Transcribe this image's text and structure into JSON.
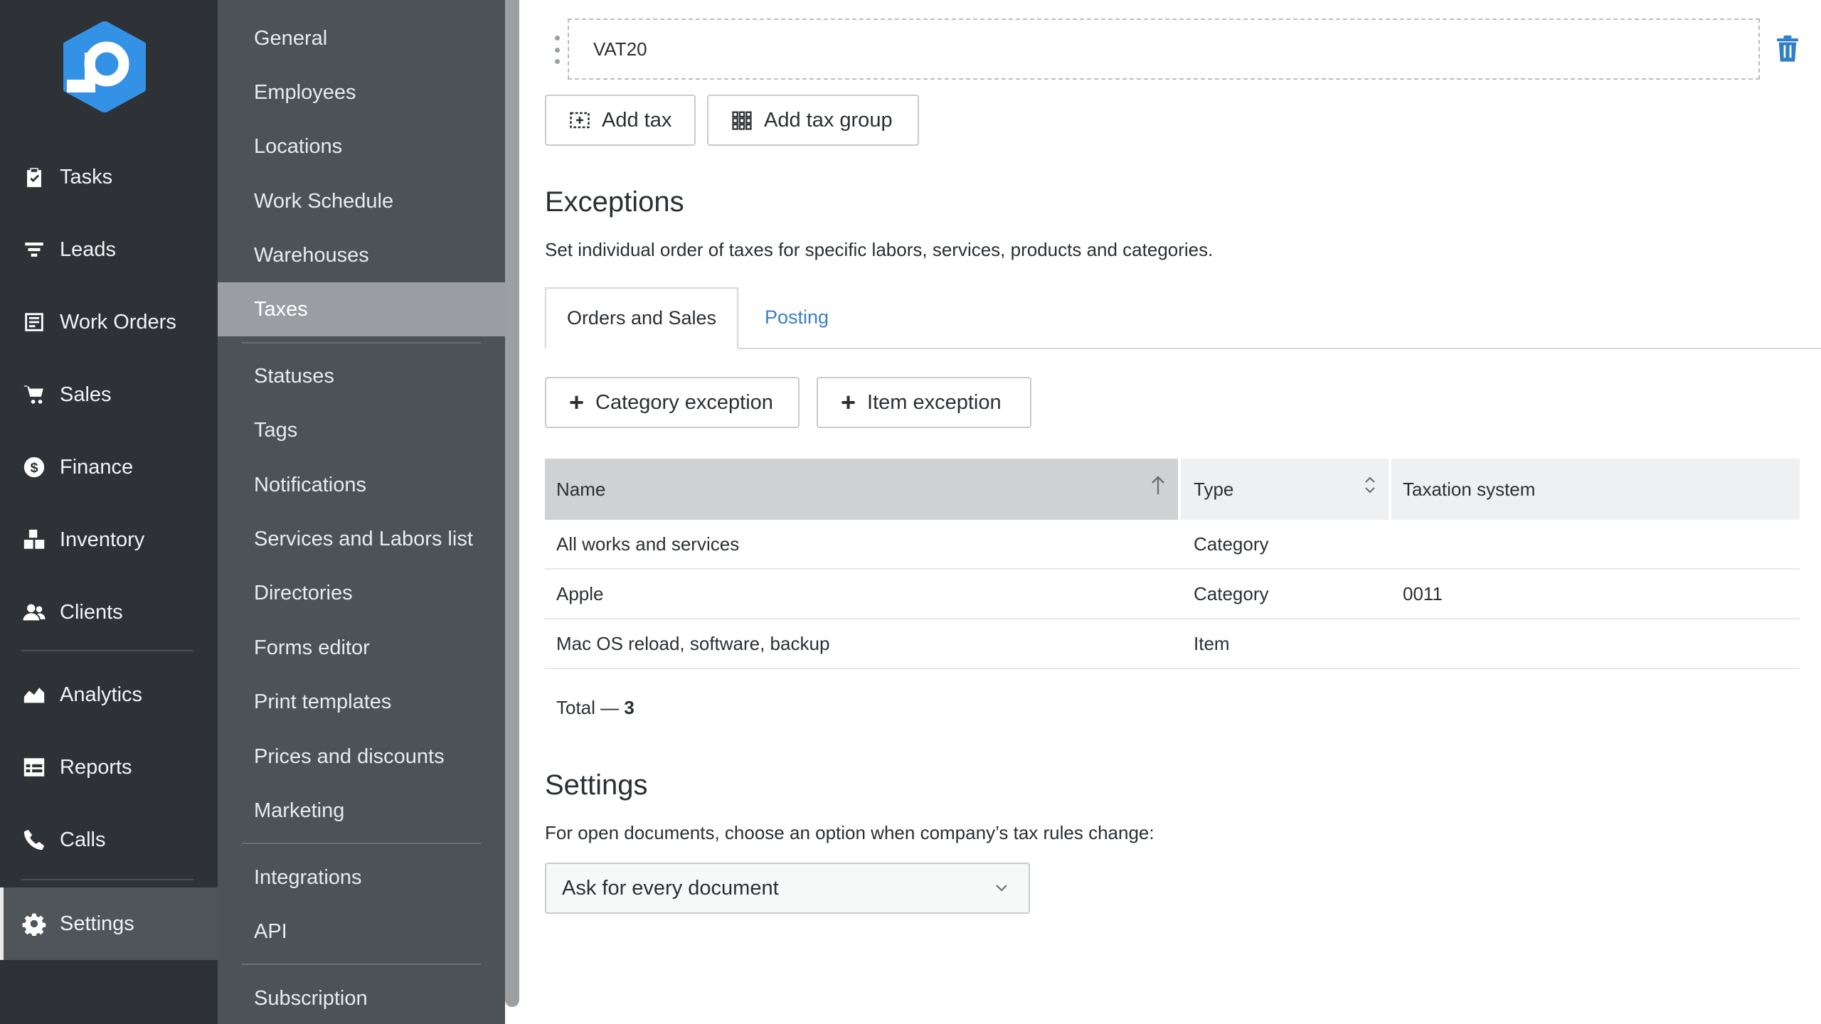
{
  "colors": {
    "primary_nav_bg": "#2e3236",
    "secondary_nav_bg": "#4d5257",
    "active_secondary_bg": "#9a9ea2",
    "logo_blue": "#3391e6",
    "link_blue": "#3b7fc4",
    "delete_icon_blue": "#2f7ec9"
  },
  "primary_nav": {
    "items": [
      {
        "label": "Tasks",
        "icon": "clipboard-check-icon"
      },
      {
        "label": "Leads",
        "icon": "filter-icon"
      },
      {
        "label": "Work Orders",
        "icon": "document-list-icon"
      },
      {
        "label": "Sales",
        "icon": "cart-icon"
      },
      {
        "label": "Finance",
        "icon": "dollar-circle-icon"
      },
      {
        "label": "Inventory",
        "icon": "boxes-icon"
      },
      {
        "label": "Clients",
        "icon": "users-icon"
      },
      {
        "label": "Analytics",
        "icon": "area-chart-icon"
      },
      {
        "label": "Reports",
        "icon": "table-icon"
      },
      {
        "label": "Calls",
        "icon": "phone-icon"
      },
      {
        "label": "Settings",
        "icon": "gear-icon",
        "active": true
      }
    ]
  },
  "settings_menu": {
    "items": [
      "General",
      "Employees",
      "Locations",
      "Work Schedule",
      "Warehouses",
      "Taxes",
      "Statuses",
      "Tags",
      "Notifications",
      "Services and Labors list",
      "Directories",
      "Forms editor",
      "Print templates",
      "Prices and discounts",
      "Marketing",
      "Integrations",
      "API",
      "Subscription"
    ],
    "active": "Taxes"
  },
  "tax_row": {
    "value": "VAT20"
  },
  "buttons": {
    "add_tax": "Add tax",
    "add_tax_group": "Add tax group",
    "category_exception": "Category exception",
    "item_exception": "Item exception"
  },
  "exceptions": {
    "title": "Exceptions",
    "description": "Set individual order of taxes for specific labors, services, products and categories.",
    "tabs": [
      {
        "label": "Orders and Sales",
        "active": true
      },
      {
        "label": "Posting",
        "active": false
      }
    ],
    "table": {
      "headers": [
        "Name",
        "Type",
        "Taxation system"
      ],
      "rows": [
        [
          "All works and services",
          "Category",
          ""
        ],
        [
          "Apple",
          "Category",
          "0011"
        ],
        [
          "Mac OS reload, software, backup",
          "Item",
          ""
        ]
      ],
      "total_label": "Total — ",
      "total_value": "3"
    }
  },
  "settings_section": {
    "title": "Settings",
    "description": "For open documents, choose an option when company’s tax rules change:",
    "selected_option": "Ask for every document"
  }
}
